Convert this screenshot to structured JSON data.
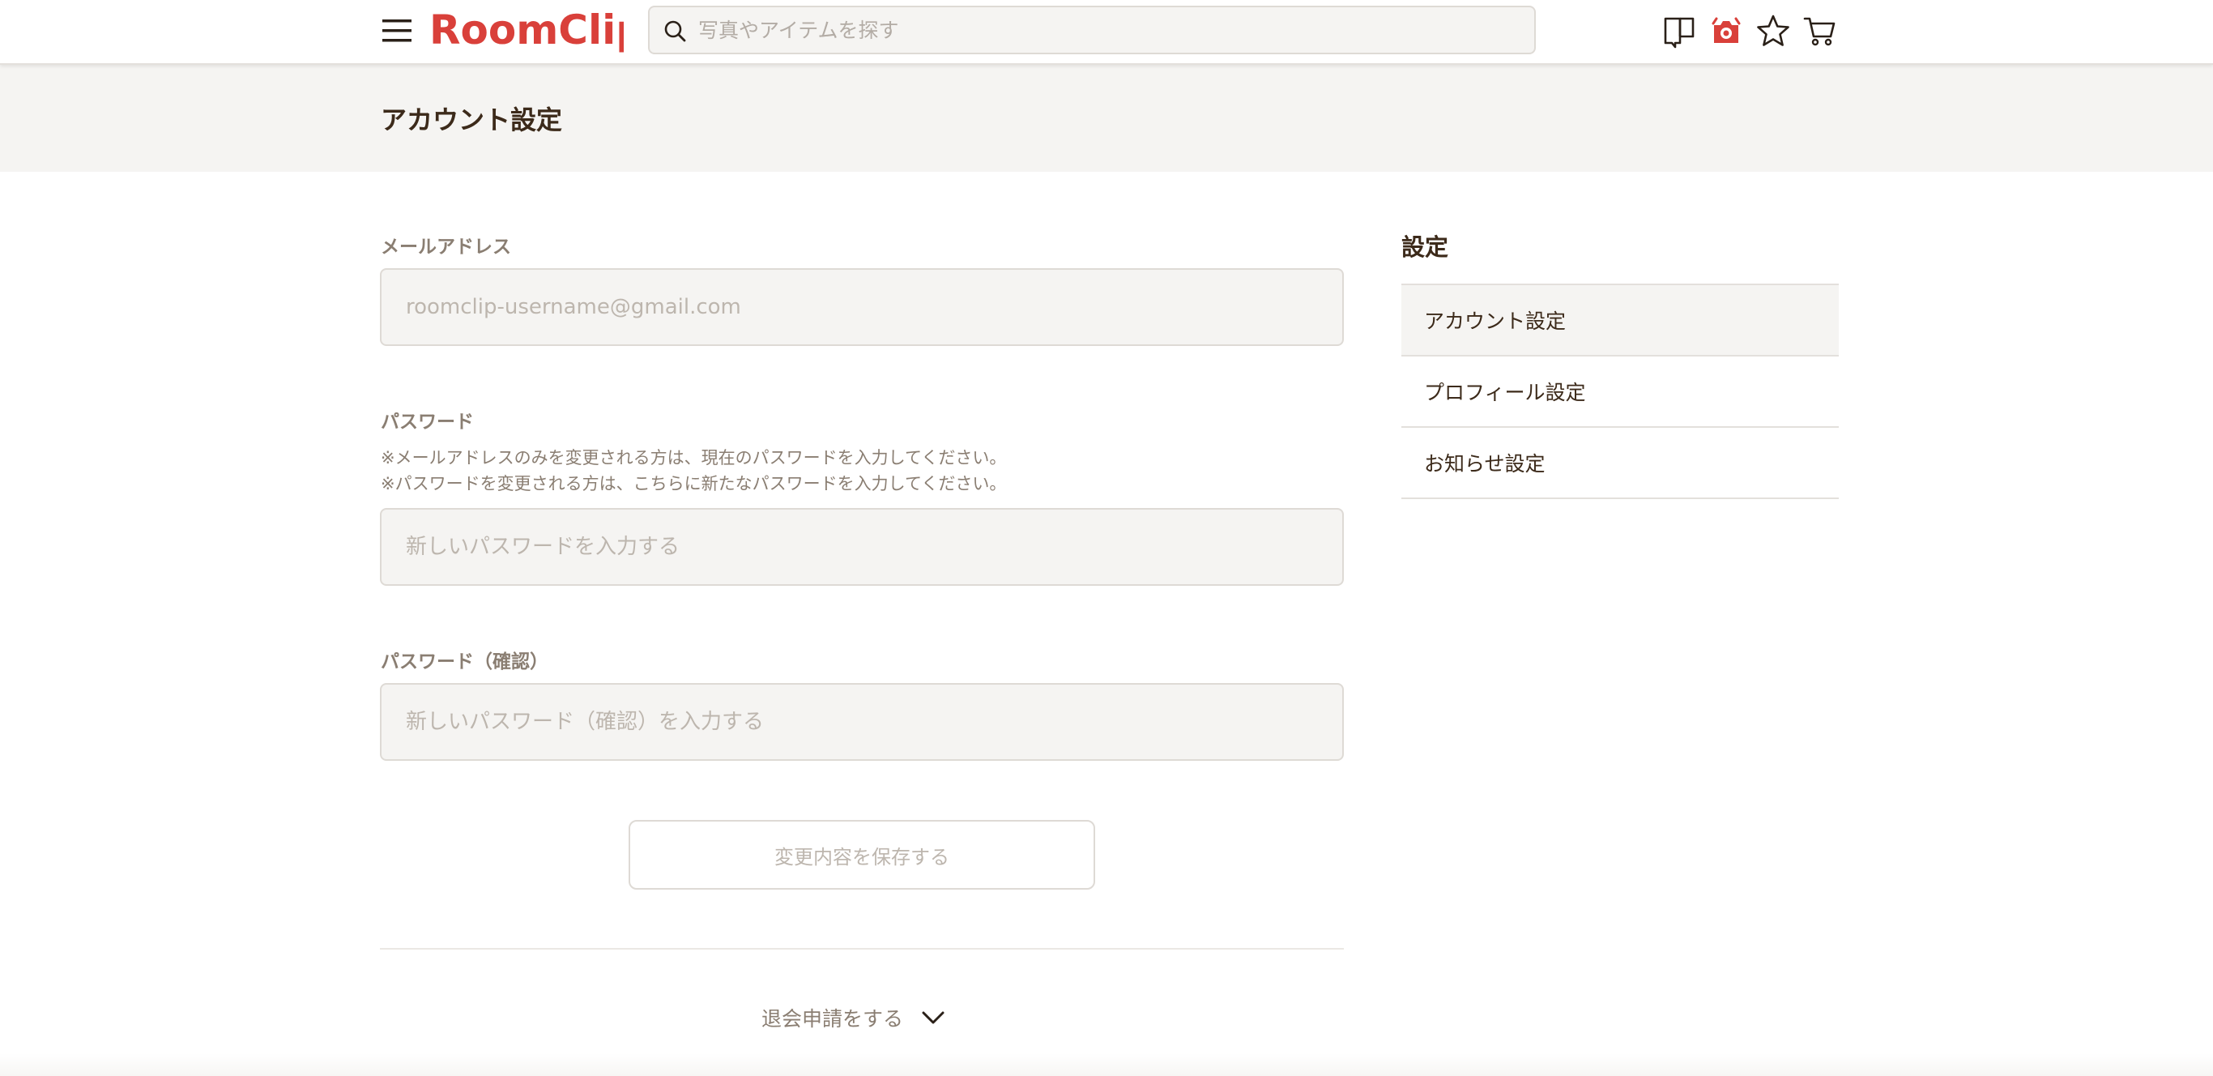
{
  "header": {
    "logo_text": "RoomClip",
    "search_placeholder": "写真やアイテムを探す"
  },
  "page_title": "アカウント設定",
  "form": {
    "email_label": "メールアドレス",
    "email_placeholder": "roomclip-username@gmail.com",
    "password_label": "パスワード",
    "password_note_1": "※メールアドレスのみを変更される方は、現在のパスワードを入力してください。",
    "password_note_2": "※パスワードを変更される方は、こちらに新たなパスワードを入力してください。",
    "password_placeholder": "新しいパスワードを入力する",
    "confirm_label": "パスワード（確認）",
    "confirm_placeholder": "新しいパスワード（確認）を入力する",
    "save_label": "変更内容を保存する",
    "withdraw_label": "退会申請をする"
  },
  "sidebar": {
    "title": "設定",
    "items": [
      {
        "label": "アカウント設定"
      },
      {
        "label": "プロフィール設定"
      },
      {
        "label": "お知らせ設定"
      }
    ]
  },
  "colors": {
    "brand_red": "#d9403a",
    "text_brown": "#3c2a1a",
    "muted_brown": "#8a7e72",
    "field_bg": "#f5f4f2"
  },
  "icons": [
    "menu-icon",
    "search-icon",
    "magazine-icon",
    "camera-post-icon",
    "star-icon",
    "cart-icon",
    "chevron-down-icon"
  ]
}
